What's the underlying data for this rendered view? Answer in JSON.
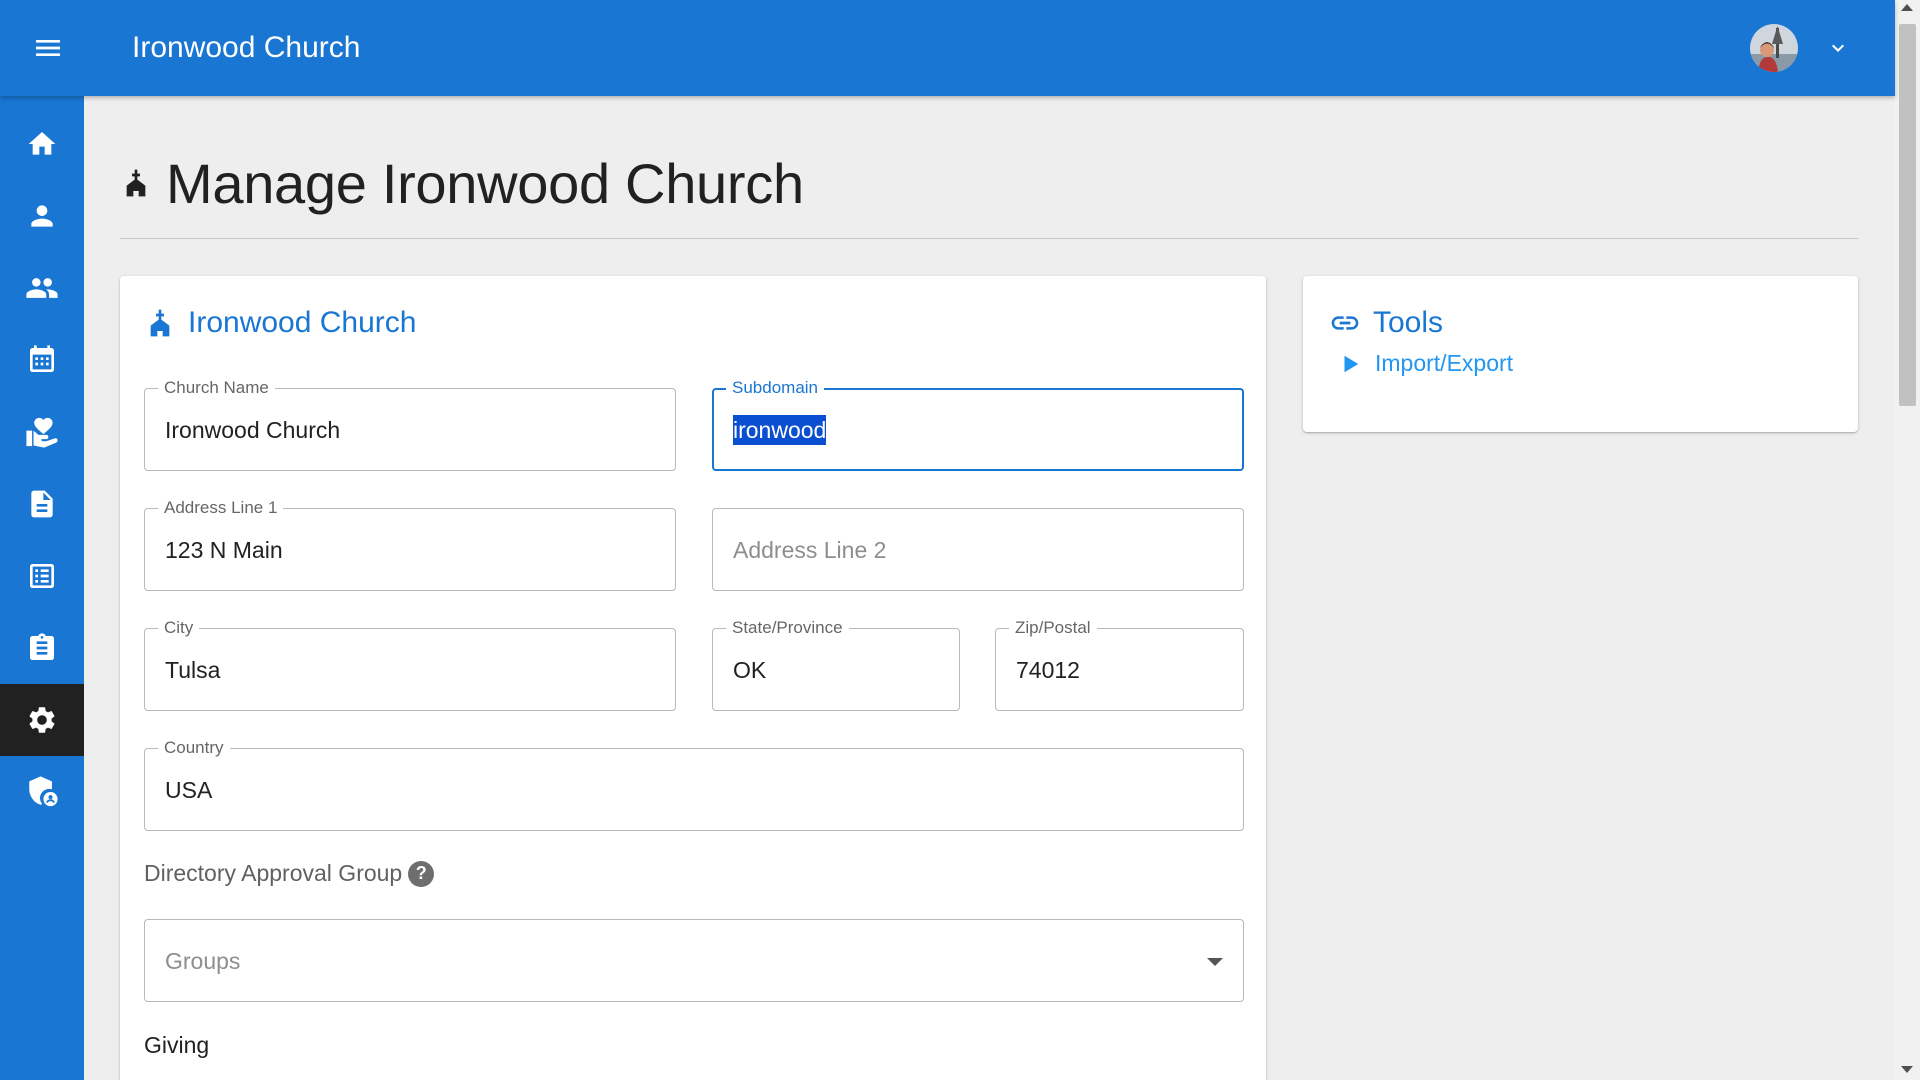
{
  "app": {
    "title": "Ironwood Church",
    "brand_color": "#1976d2",
    "active_nav_color": "#212121"
  },
  "sidebar": {
    "items": [
      {
        "icon": "home-icon",
        "active": false
      },
      {
        "icon": "person-icon",
        "active": false
      },
      {
        "icon": "people-icon",
        "active": false
      },
      {
        "icon": "calendar-icon",
        "active": false
      },
      {
        "icon": "volunteer-hand-heart-icon",
        "active": false
      },
      {
        "icon": "document-icon",
        "active": false
      },
      {
        "icon": "list-icon",
        "active": false
      },
      {
        "icon": "clipboard-icon",
        "active": false
      },
      {
        "icon": "gear-icon",
        "active": true
      },
      {
        "icon": "admin-shield-icon",
        "active": false
      }
    ]
  },
  "page": {
    "title": "Manage Ironwood Church"
  },
  "church_card": {
    "title": "Ironwood Church",
    "fields": {
      "church_name": {
        "label": "Church Name",
        "value": "Ironwood Church"
      },
      "subdomain": {
        "label": "Subdomain",
        "value": "ironwood"
      },
      "address1": {
        "label": "Address Line 1",
        "value": "123 N Main"
      },
      "address2": {
        "placeholder": "Address Line 2"
      },
      "city": {
        "label": "City",
        "value": "Tulsa"
      },
      "state": {
        "label": "State/Province",
        "value": "OK"
      },
      "zip": {
        "label": "Zip/Postal",
        "value": "74012"
      },
      "country": {
        "label": "Country",
        "value": "USA"
      }
    },
    "directory_approval": {
      "label": "Directory Approval Group",
      "help": "?",
      "select_placeholder": "Groups"
    },
    "giving_label": "Giving"
  },
  "tools_card": {
    "title": "Tools",
    "links": [
      {
        "label": "Import/Export"
      }
    ]
  }
}
